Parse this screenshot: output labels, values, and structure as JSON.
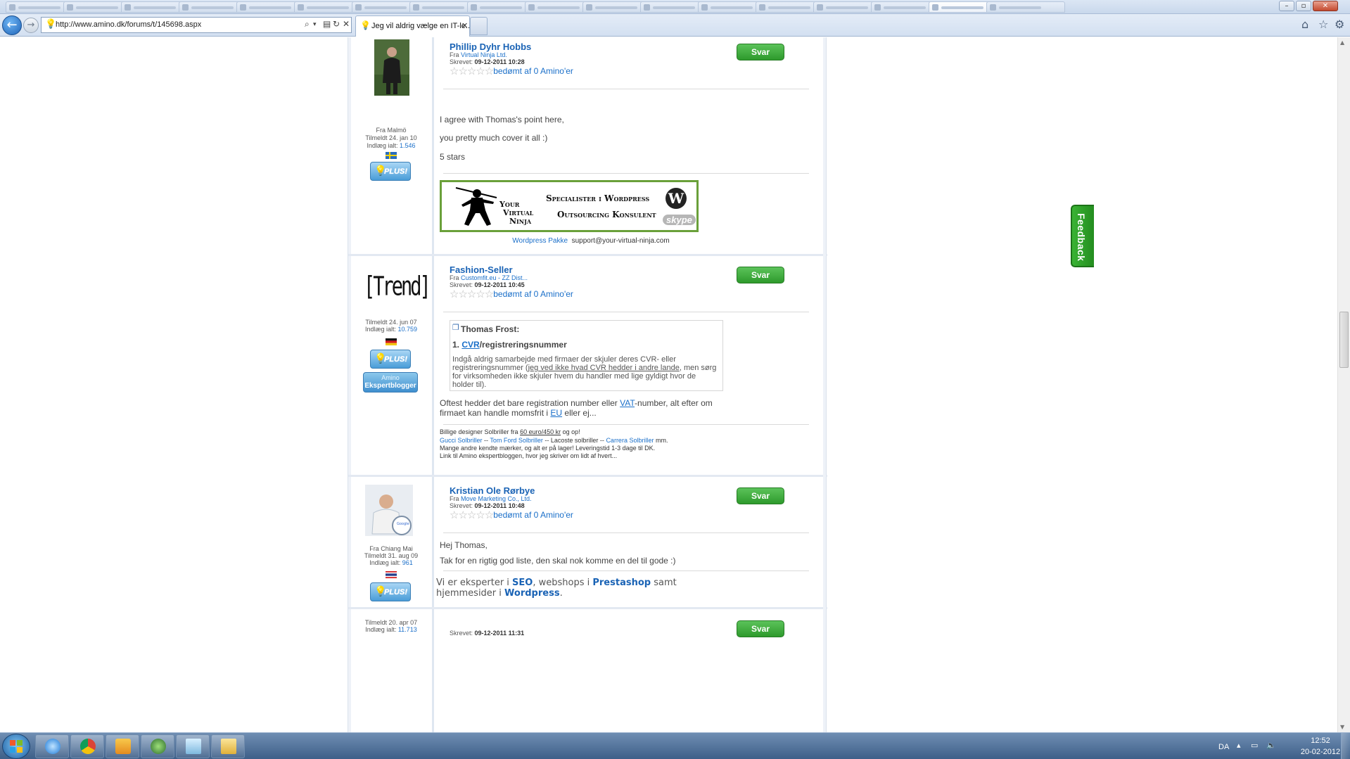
{
  "browser": {
    "address_url": "http://www.amino.dk/forums/t/145698.aspx",
    "active_tab_title": "Jeg vil aldrig vælge en IT-le...",
    "icons": {
      "back": "back-arrow-icon",
      "forward": "forward-arrow-icon",
      "search": "search-icon",
      "compat": "compatibility-view-icon",
      "refresh": "refresh-icon",
      "stop": "stop-icon",
      "home": "home-icon",
      "favorites": "favorites-star-icon",
      "tools": "gear-icon"
    }
  },
  "posts": [
    {
      "author": "Phillip Dyhr Hobbs",
      "from_label": "Fra",
      "company": "Virtual Ninja Ltd.",
      "written_label": "Skrevet:",
      "written": "09-12-2011 10:28",
      "rating": "bedømt af 0 Amino'er",
      "reply": "Svar",
      "user_location": "Fra Malmö",
      "joined": "Tilmeldt 24. jan 10",
      "posts_label": "Indlæg ialt:",
      "posts_count": "1.546",
      "flag": "sweden",
      "badges": [
        "PLUS!"
      ],
      "body": [
        "I agree with Thomas's point here,",
        "you pretty much cover it all :)",
        "5 stars"
      ],
      "banner": {
        "logo_line1": "Your",
        "logo_line2": "Virtual",
        "logo_line3": "Ninja",
        "tagline1": "Specialister i Wordpress",
        "tagline2": "Outsourcing Konsulent",
        "wp_mark": "W",
        "skype_mark": "skype"
      },
      "banner_link": "Wordpress Pakke",
      "banner_email": "support@your-virtual-ninja.com"
    },
    {
      "author": "Fashion-Seller",
      "from_label": "Fra",
      "company": "Customfit.eu - ZZ Dist...",
      "written_label": "Skrevet:",
      "written": "09-12-2011 10:45",
      "rating": "bedømt af 0 Amino'er",
      "reply": "Svar",
      "avatar_text": "[Trend]",
      "joined": "Tilmeldt 24. jun 07",
      "posts_label": "Indlæg ialt:",
      "posts_count": "10.759",
      "flag": "germany",
      "badges": [
        "PLUS!"
      ],
      "expert_badge": {
        "line1": "Amino",
        "line2": "Ekspertblogger"
      },
      "quote": {
        "author": "Thomas Frost:",
        "heading_num": "1.",
        "heading_link": "CVR",
        "heading_rest": "/registreringsnummer",
        "body_a": "Indgå aldrig samarbejde med firmaer der skjuler deres CVR- eller registreringsnummer (",
        "body_underlined": "jeg ved ikke hvad CVR hedder i andre lande",
        "body_b": ", men sørg for virksomheden ikke skjuler hvem du handler med lige gyldigt hvor de holder til)."
      },
      "body_a": "Oftest hedder det bare registration number eller ",
      "body_link_vat": "VAT",
      "body_b": "-number, alt efter om firmaet kan handle momsfrit i ",
      "body_link_eu": "EU",
      "body_c": " eller ej...",
      "signature": {
        "line1_a": "Billige designer Solbriller fra ",
        "line1_u": "60 euro/450 kr",
        "line1_b": " og op!",
        "line2_link1": "Gucci Solbriller",
        "line2_sep1": " --  ",
        "line2_link2": "Tom Ford Solbriller",
        "line2_mid": " -- Lacoste solbriller -- ",
        "line2_link3": "Carrera Solbriller",
        "line2_end": " mm.",
        "line3": "Mange andre kendte mærker, og alt er på lager! Leveringstid 1-3 dage til DK.",
        "line4": "Link til Amino ekspertbloggen, hvor jeg skriver om lidt af hvert..."
      }
    },
    {
      "author": "Kristian Ole Rørbye",
      "from_label": "Fra",
      "company": "Move Marketing Co., Ltd.",
      "written_label": "Skrevet:",
      "written": "09-12-2011 10:48",
      "rating": "bedømt af 0 Amino'er",
      "reply": "Svar",
      "user_location": "Fra Chiang Mai",
      "joined": "Tilmeldt 31. aug 09",
      "posts_label": "Indlæg ialt:",
      "posts_count": "961",
      "flag": "thailand",
      "badges": [
        "PLUS!"
      ],
      "body": [
        "Hej Thomas,",
        "Tak for en rigtig god liste, den skal nok komme en del til gode :)"
      ],
      "sig_a": "Vi er eksperter i ",
      "sig_seo": "SEO",
      "sig_b": ", webshops i ",
      "sig_presta": "Prestashop",
      "sig_c": " samt hjemmesider i ",
      "sig_wp": "Wordpress",
      "sig_d": "."
    },
    {
      "joined": "Tilmeldt 20. apr 07",
      "posts_label": "Indlæg ialt:",
      "posts_count": "11.713",
      "written_label": "Skrevet:",
      "written": "09-12-2011 11:31",
      "reply": "Svar"
    }
  ],
  "feedback_tab": "Feedback",
  "taskbar": {
    "language": "DA",
    "time": "12:52",
    "date": "20-02-2012",
    "apps": [
      "internet-explorer-icon",
      "chrome-icon",
      "outlook-icon",
      "media-player-icon",
      "notepad-icon",
      "explorer-folder-icon"
    ]
  },
  "colors": {
    "accent": "#1a63b5",
    "button_green": "#2e9a2c",
    "badge_blue": "#4a9dd8"
  }
}
